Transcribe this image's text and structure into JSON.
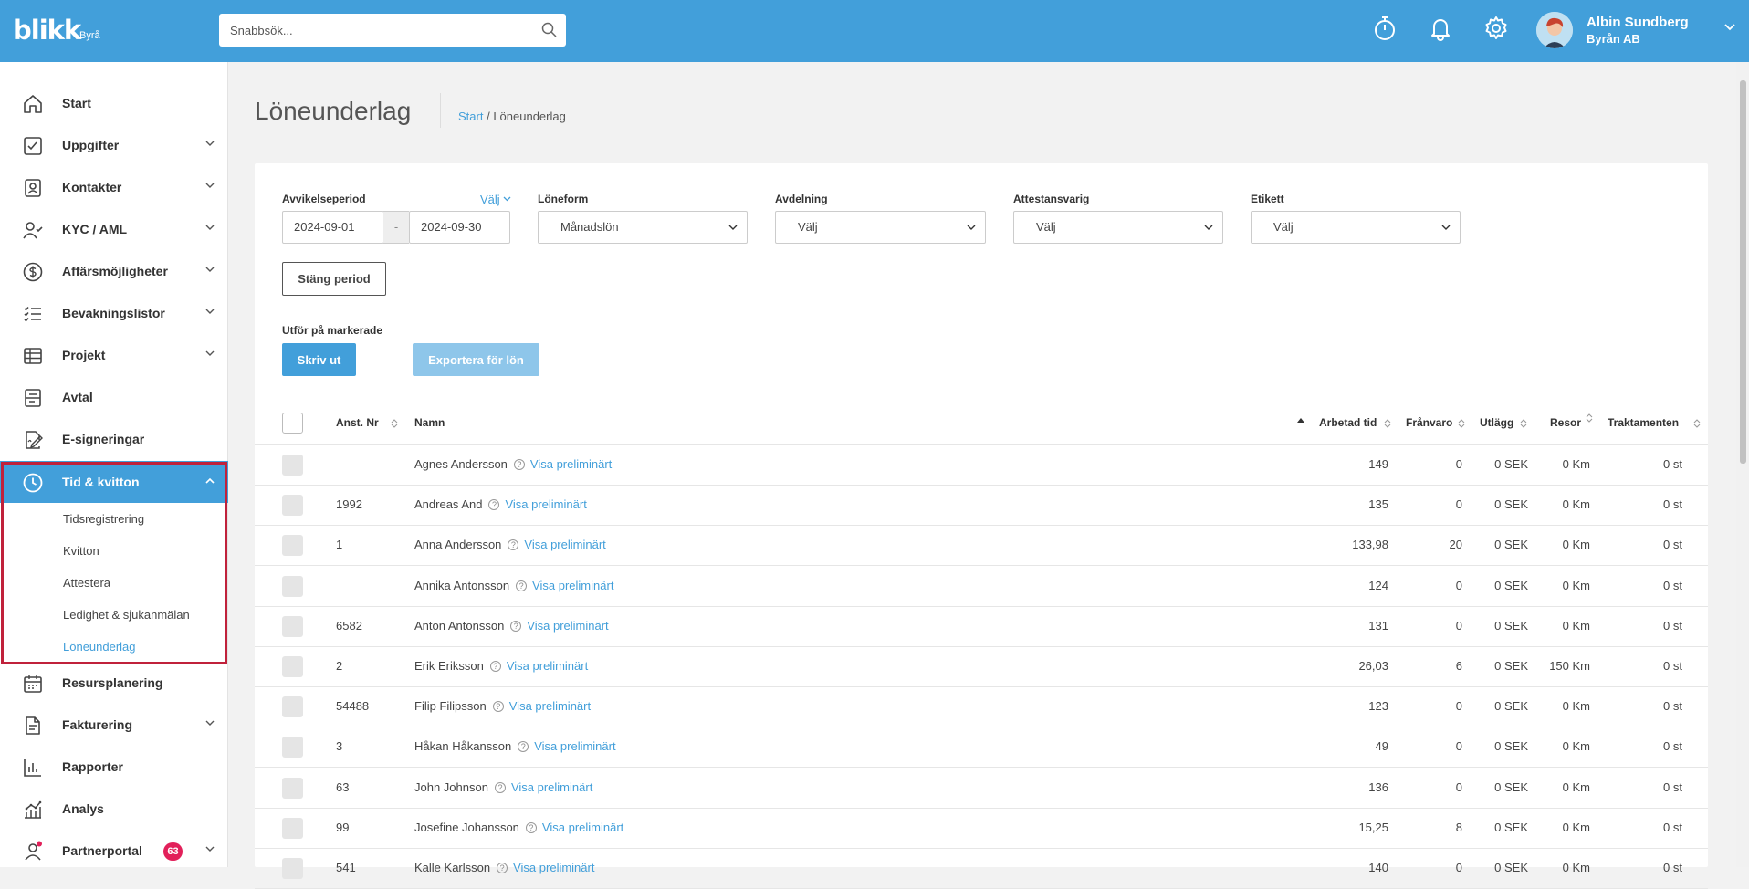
{
  "header": {
    "logo": "blikk",
    "logo_sub": "Byrå",
    "search_placeholder": "Snabbsök...",
    "icons": [
      "stopwatch-icon",
      "bell-icon",
      "gear-icon"
    ],
    "user_name": "Albin Sundberg",
    "user_org": "Byrån AB"
  },
  "sidebar": {
    "items": [
      {
        "label": "Start",
        "icon": "home-icon",
        "chevron": false
      },
      {
        "label": "Uppgifter",
        "icon": "checkbox-icon",
        "chevron": true
      },
      {
        "label": "Kontakter",
        "icon": "contacts-icon",
        "chevron": true
      },
      {
        "label": "KYC / AML",
        "icon": "user-check-icon",
        "chevron": true
      },
      {
        "label": "Affärsmöjligheter",
        "icon": "dollar-icon",
        "chevron": true
      },
      {
        "label": "Bevakningslistor",
        "icon": "checklist-icon",
        "chevron": true
      },
      {
        "label": "Projekt",
        "icon": "table-icon",
        "chevron": true
      },
      {
        "label": "Avtal",
        "icon": "contract-icon",
        "chevron": false
      },
      {
        "label": "E-signeringar",
        "icon": "signature-icon",
        "chevron": false
      },
      {
        "label": "Tid & kvitton",
        "icon": "clock-icon",
        "chevron": true,
        "active": true
      },
      {
        "label": "Resursplanering",
        "icon": "calendar-icon",
        "chevron": false
      },
      {
        "label": "Fakturering",
        "icon": "invoice-icon",
        "chevron": true
      },
      {
        "label": "Rapporter",
        "icon": "bar-chart-icon",
        "chevron": false
      },
      {
        "label": "Analys",
        "icon": "analytics-icon",
        "chevron": false
      },
      {
        "label": "Partnerportal",
        "icon": "partner-icon",
        "chevron": true,
        "badge": "63"
      }
    ],
    "sub_items": [
      "Tidsregistrering",
      "Kvitton",
      "Attestera",
      "Ledighet & sjukanmälan",
      "Löneunderlag"
    ],
    "current_sub": "Löneunderlag",
    "accent": "#429fda",
    "highlight_color": "#c0213b"
  },
  "page": {
    "title": "Löneunderlag",
    "breadcrumb_start": "Start",
    "breadcrumb_sep": " / ",
    "breadcrumb_current": "Löneunderlag"
  },
  "filters": {
    "period_label": "Avvikelseperiod",
    "valj_link": "Välj",
    "date_from": "2024-09-01",
    "date_sep": "-",
    "date_to": "2024-09-30",
    "loneform_label": "Löneform",
    "loneform_value": "Månadslön",
    "avdelning_label": "Avdelning",
    "avdelning_value": "Välj",
    "attest_label": "Attestansvarig",
    "attest_value": "Välj",
    "etikett_label": "Etikett",
    "etikett_value": "Välj",
    "close_period": "Stäng period",
    "bulk_label": "Utför på markerade",
    "print_button": "Skriv ut",
    "export_button": "Exportera för lön"
  },
  "table": {
    "columns": {
      "anst_nr": "Anst. Nr",
      "namn": "Namn",
      "arbetad_tid": "Arbetad tid",
      "franvaro": "Frånvaro",
      "utlagg": "Utlägg",
      "resor": "Resor",
      "traktamenten": "Traktamenten"
    },
    "preview_link": "Visa preliminärt",
    "rows": [
      {
        "nr": "",
        "name": "Agnes Andersson",
        "tid": "149",
        "franvaro": "0",
        "utlagg": "0 SEK",
        "resor": "0 Km",
        "trakt": "0 st"
      },
      {
        "nr": "1992",
        "name": "Andreas And",
        "tid": "135",
        "franvaro": "0",
        "utlagg": "0 SEK",
        "resor": "0 Km",
        "trakt": "0 st"
      },
      {
        "nr": "1",
        "name": "Anna Andersson",
        "tid": "133,98",
        "franvaro": "20",
        "utlagg": "0 SEK",
        "resor": "0 Km",
        "trakt": "0 st"
      },
      {
        "nr": "",
        "name": "Annika Antonsson",
        "tid": "124",
        "franvaro": "0",
        "utlagg": "0 SEK",
        "resor": "0 Km",
        "trakt": "0 st"
      },
      {
        "nr": "6582",
        "name": "Anton Antonsson",
        "tid": "131",
        "franvaro": "0",
        "utlagg": "0 SEK",
        "resor": "0 Km",
        "trakt": "0 st"
      },
      {
        "nr": "2",
        "name": "Erik Eriksson",
        "tid": "26,03",
        "franvaro": "6",
        "utlagg": "0 SEK",
        "resor": "150 Km",
        "trakt": "0 st"
      },
      {
        "nr": "54488",
        "name": "Filip Filipsson",
        "tid": "123",
        "franvaro": "0",
        "utlagg": "0 SEK",
        "resor": "0 Km",
        "trakt": "0 st"
      },
      {
        "nr": "3",
        "name": "Håkan Håkansson",
        "tid": "49",
        "franvaro": "0",
        "utlagg": "0 SEK",
        "resor": "0 Km",
        "trakt": "0 st"
      },
      {
        "nr": "63",
        "name": "John Johnson",
        "tid": "136",
        "franvaro": "0",
        "utlagg": "0 SEK",
        "resor": "0 Km",
        "trakt": "0 st"
      },
      {
        "nr": "99",
        "name": "Josefine Johansson",
        "tid": "15,25",
        "franvaro": "8",
        "utlagg": "0 SEK",
        "resor": "0 Km",
        "trakt": "0 st"
      },
      {
        "nr": "541",
        "name": "Kalle Karlsson",
        "tid": "140",
        "franvaro": "0",
        "utlagg": "0 SEK",
        "resor": "0 Km",
        "trakt": "0 st"
      }
    ]
  }
}
